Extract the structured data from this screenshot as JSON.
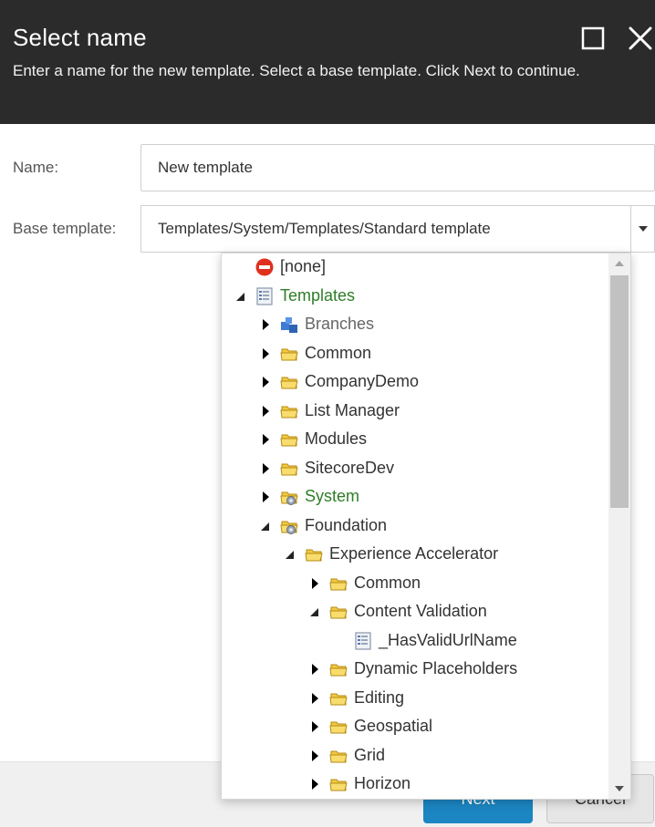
{
  "dialog": {
    "title": "Select name",
    "subtitle": "Enter a name for the new template. Select a base template. Click Next to continue."
  },
  "form": {
    "name_label": "Name:",
    "name_value": "New template",
    "base_label": "Base template:",
    "base_value": "Templates/System/Templates/Standard template"
  },
  "footer": {
    "next_label": "Next",
    "cancel_label": "Cancel"
  },
  "tree": {
    "items": [
      {
        "label": "[none]",
        "icon": "none-icon",
        "expander": "none",
        "color": "normal"
      },
      {
        "label": "Templates",
        "icon": "template-icon",
        "expander": "expanded",
        "color": "green"
      },
      {
        "label": "Branches",
        "icon": "branch-icon",
        "expander": "collapsed",
        "color": "grey"
      },
      {
        "label": "Common",
        "icon": "folder-icon",
        "expander": "collapsed",
        "color": "normal"
      },
      {
        "label": "CompanyDemo",
        "icon": "folder-icon",
        "expander": "collapsed",
        "color": "normal"
      },
      {
        "label": "List Manager",
        "icon": "folder-icon",
        "expander": "collapsed",
        "color": "normal"
      },
      {
        "label": "Modules",
        "icon": "folder-icon",
        "expander": "collapsed",
        "color": "normal"
      },
      {
        "label": "SitecoreDev",
        "icon": "folder-icon",
        "expander": "collapsed",
        "color": "normal"
      },
      {
        "label": "System",
        "icon": "system-folder-icon",
        "expander": "collapsed",
        "color": "green"
      },
      {
        "label": "Foundation",
        "icon": "system-folder-icon",
        "expander": "expanded",
        "color": "normal"
      },
      {
        "label": "Experience Accelerator",
        "icon": "folder-icon",
        "expander": "expanded",
        "color": "normal"
      },
      {
        "label": "Common",
        "icon": "folder-icon",
        "expander": "collapsed",
        "color": "normal"
      },
      {
        "label": "Content Validation",
        "icon": "folder-icon",
        "expander": "expanded",
        "color": "normal"
      },
      {
        "label": "_HasValidUrlName",
        "icon": "template-icon",
        "expander": "none",
        "color": "normal"
      },
      {
        "label": "Dynamic Placeholders",
        "icon": "folder-icon",
        "expander": "collapsed",
        "color": "normal"
      },
      {
        "label": "Editing",
        "icon": "folder-icon",
        "expander": "collapsed",
        "color": "normal"
      },
      {
        "label": "Geospatial",
        "icon": "folder-icon",
        "expander": "collapsed",
        "color": "normal"
      },
      {
        "label": "Grid",
        "icon": "folder-icon",
        "expander": "collapsed",
        "color": "normal"
      },
      {
        "label": "Horizon",
        "icon": "folder-icon",
        "expander": "collapsed",
        "color": "normal"
      }
    ]
  },
  "colors": {
    "header_bg": "#2b2b2b",
    "accent": "#1c86c2",
    "tree_green": "#2e7d27",
    "folder_yellow": "#f6d34a"
  }
}
